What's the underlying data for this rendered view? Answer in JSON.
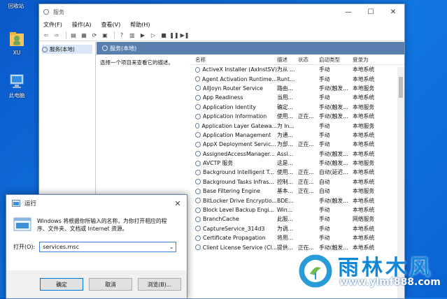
{
  "desktop": {
    "icons": [
      {
        "label": "回收站"
      },
      {
        "label": "XU"
      },
      {
        "label": "此电脑"
      }
    ]
  },
  "services_window": {
    "title": "服务",
    "menu": [
      "文件(F)",
      "操作(A)",
      "查看(V)",
      "帮助(H)"
    ],
    "tree_item": "服务(本地)",
    "content_header": "服务(本地)",
    "description_prompt": "选择一个项目来查看它的描述。",
    "columns": {
      "name": "名称",
      "desc": "描述",
      "status": "状态",
      "startup": "启动类型",
      "logon": "登录为"
    },
    "rows": [
      {
        "name": "ActiveX Installer (AxInstSV)",
        "desc": "为从 ...",
        "status": "",
        "startup": "手动",
        "logon": "本地系统"
      },
      {
        "name": "Agent Activation Runtime...",
        "desc": "Runt...",
        "status": "",
        "startup": "手动",
        "logon": "本地系统"
      },
      {
        "name": "AllJoyn Router Service",
        "desc": "路由...",
        "status": "",
        "startup": "手动(触发...",
        "logon": "本地服务"
      },
      {
        "name": "App Readiness",
        "desc": "当用...",
        "status": "",
        "startup": "手动",
        "logon": "本地系统"
      },
      {
        "name": "Application Identity",
        "desc": "确定...",
        "status": "",
        "startup": "手动(触发...",
        "logon": "本地服务"
      },
      {
        "name": "Application Information",
        "desc": "使用...",
        "status": "正在...",
        "startup": "手动(触发...",
        "logon": "本地系统"
      },
      {
        "name": "Application Layer Gatewa...",
        "desc": "为 In...",
        "status": "",
        "startup": "手动",
        "logon": "本地服务"
      },
      {
        "name": "Application Management",
        "desc": "为通...",
        "status": "",
        "startup": "手动",
        "logon": "本地系统"
      },
      {
        "name": "AppX Deployment Servic...",
        "desc": "为部...",
        "status": "正在...",
        "startup": "手动",
        "logon": "本地系统"
      },
      {
        "name": "AssignedAccessManager...",
        "desc": "Assi...",
        "status": "",
        "startup": "手动(触发...",
        "logon": "本地系统"
      },
      {
        "name": "AVCTP 服务",
        "desc": "这是...",
        "status": "",
        "startup": "手动(触发...",
        "logon": "本地服务"
      },
      {
        "name": "Background Intelligent T...",
        "desc": "使用...",
        "status": "正在...",
        "startup": "自动(延迟...",
        "logon": "本地系统"
      },
      {
        "name": "Background Tasks Infras...",
        "desc": "控制...",
        "status": "正在...",
        "startup": "自动",
        "logon": "本地系统"
      },
      {
        "name": "Base Filtering Engine",
        "desc": "基本...",
        "status": "正在...",
        "startup": "自动",
        "logon": "本地服务"
      },
      {
        "name": "BitLocker Drive Encryptio...",
        "desc": "BDE...",
        "status": "",
        "startup": "手动(触发...",
        "logon": "本地系统"
      },
      {
        "name": "Block Level Backup Engi...",
        "desc": "Win...",
        "status": "",
        "startup": "手动",
        "logon": "本地系统"
      },
      {
        "name": "BranchCache",
        "desc": "此服...",
        "status": "",
        "startup": "手动",
        "logon": "网络服务"
      },
      {
        "name": "CaptureService_314d3",
        "desc": "为调...",
        "status": "",
        "startup": "手动",
        "logon": "本地系统"
      },
      {
        "name": "Certificate Propagation",
        "desc": "将用...",
        "status": "",
        "startup": "手动",
        "logon": "本地系统"
      },
      {
        "name": "Client License Service (Cl...",
        "desc": "提供...",
        "status": "正在...",
        "startup": "手动(触发...",
        "logon": "本地系统"
      }
    ]
  },
  "run_dialog": {
    "title": "运行",
    "prompt": "Windows 将根据你所输入的名称，为你打开相应的程序、文件夹、文档或 Internet 资源。",
    "open_label": "打开(O):",
    "input_value": "services.msc",
    "ok_label": "确定",
    "cancel_label": "取消",
    "browse_label": "浏览(B)..."
  },
  "watermark": {
    "brand": "雨林木风",
    "url": "www.ylmf888.com"
  },
  "colors": {
    "desktop": "#0f6fdc",
    "header_bar": "#5a7fae",
    "accent": "#0078d7",
    "watermark": "#0f86d6"
  }
}
